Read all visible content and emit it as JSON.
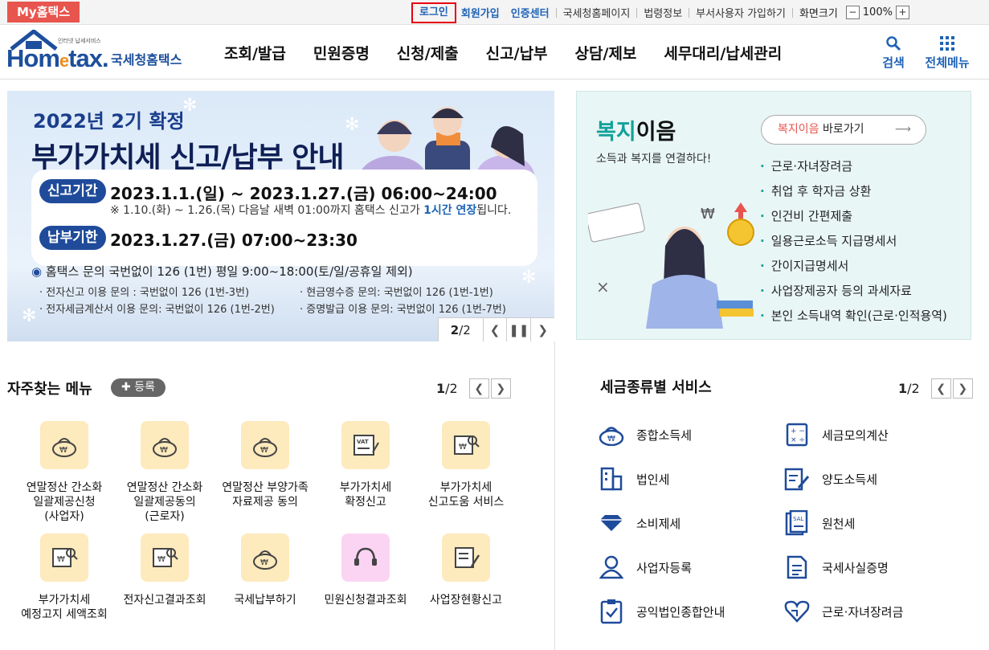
{
  "topbar": {
    "my_hometax": "My홈택스",
    "login": "로그인",
    "signup": "회원가입",
    "cert_center": "인증센터",
    "nts_homepage": "국세청홈페이지",
    "law_info": "법령정보",
    "dept_user_join": "부서사용자 가입하기",
    "screen_size": "화면크기",
    "zoom_minus": "−",
    "zoom_value": "100%",
    "zoom_plus": "+"
  },
  "header": {
    "logo_mini": "인터넷 납세서비스",
    "logo_word_a": "Hom",
    "logo_word_b": "e",
    "logo_word_c": "tax.",
    "logo_kr": "국세청홈택스",
    "nav": [
      "조회/발급",
      "민원증명",
      "신청/제출",
      "신고/납부",
      "상담/제보",
      "세무대리/납세관리"
    ],
    "search": "검색",
    "all_menu": "전체메뉴",
    "accent": "#1e63b6"
  },
  "banner": {
    "year": "2022년 2기 확정",
    "title": "부가가치세 신고/납부 안내",
    "period_label": "신고기간",
    "period_value": "2023.1.1.(일) ~ 2023.1.27.(금) 06:00~24:00",
    "note_a": "※ 1.10.(화) ~ 1.26.(목) 다음날 새벽 01:00까지 홈택스 신고가 ",
    "note_hl": "1시간 연장",
    "note_b": "됩니다.",
    "due_label": "납부기한",
    "due_value": "2023.1.27.(금) 07:00~23:30",
    "info": "홈택스 문의 국번없이 126 (1번) 평일 9:00~18:00(토/일/공휴일 제외)",
    "sub1": "· 전자신고 이용 문의 : 국번없이 126 (1번-3번)",
    "sub2": "· 현금영수증 문의: 국번없이 126 (1번-1번)",
    "sub3": "· 전자세금계산서 이용 문의: 국번없이 126 (1번-2번)",
    "sub4": "· 증명발급 이용 문의: 국번없이 126 (1번-7번)",
    "page_current": "2",
    "page_total": "/2"
  },
  "welfare": {
    "title_a": "복지",
    "title_b": "이음",
    "subtitle": "소득과 복지를 연결하다!",
    "button_a": "복지이음",
    "button_b": " 바로가기",
    "items": [
      "근로·자녀장려금",
      "취업 후 학자금 상환",
      "인건비 간편제출",
      "일용근로소득 지급명세서",
      "간이지급명세서",
      "사업장제공자 등의 과세자료",
      "본인 소득내역 확인(근로·인적용역)"
    ],
    "accent": "#12a19a"
  },
  "frequent": {
    "title": "자주찾는 메뉴",
    "register": "✚ 등록",
    "page_current": "1",
    "page_total": "/2",
    "items": [
      {
        "label": "연말정산 간소화\n일괄제공신청\n(사업자)",
        "icon": "money-bag-icon"
      },
      {
        "label": "연말정산 간소화\n일괄제공동의\n(근로자)",
        "icon": "money-bag-icon"
      },
      {
        "label": "연말정산 부양가족\n자료제공 동의",
        "icon": "money-bag-icon"
      },
      {
        "label": "부가가치세\n확정신고",
        "icon": "vat-icon"
      },
      {
        "label": "부가가치세\n신고도움 서비스",
        "icon": "won-search-icon"
      },
      {
        "label": "부가가치세\n예정고지 세액조회",
        "icon": "won-search-icon"
      },
      {
        "label": "전자신고결과조회",
        "icon": "won-search-icon"
      },
      {
        "label": "국세납부하기",
        "icon": "money-bag-icon"
      },
      {
        "label": "민원신청결과조회",
        "icon": "headset-icon"
      },
      {
        "label": "사업장현황신고",
        "icon": "document-edit-icon"
      }
    ]
  },
  "services": {
    "title": "세금종류별 서비스",
    "page_current": "1",
    "page_total": "/2",
    "left": [
      "종합소득세",
      "법인세",
      "소비제세",
      "사업자등록",
      "공익법인종합안내"
    ],
    "right": [
      "세금모의계산",
      "양도소득세",
      "원천세",
      "국세사실증명",
      "근로·자녀장려금"
    ],
    "icon_color": "#1f4b9a"
  }
}
